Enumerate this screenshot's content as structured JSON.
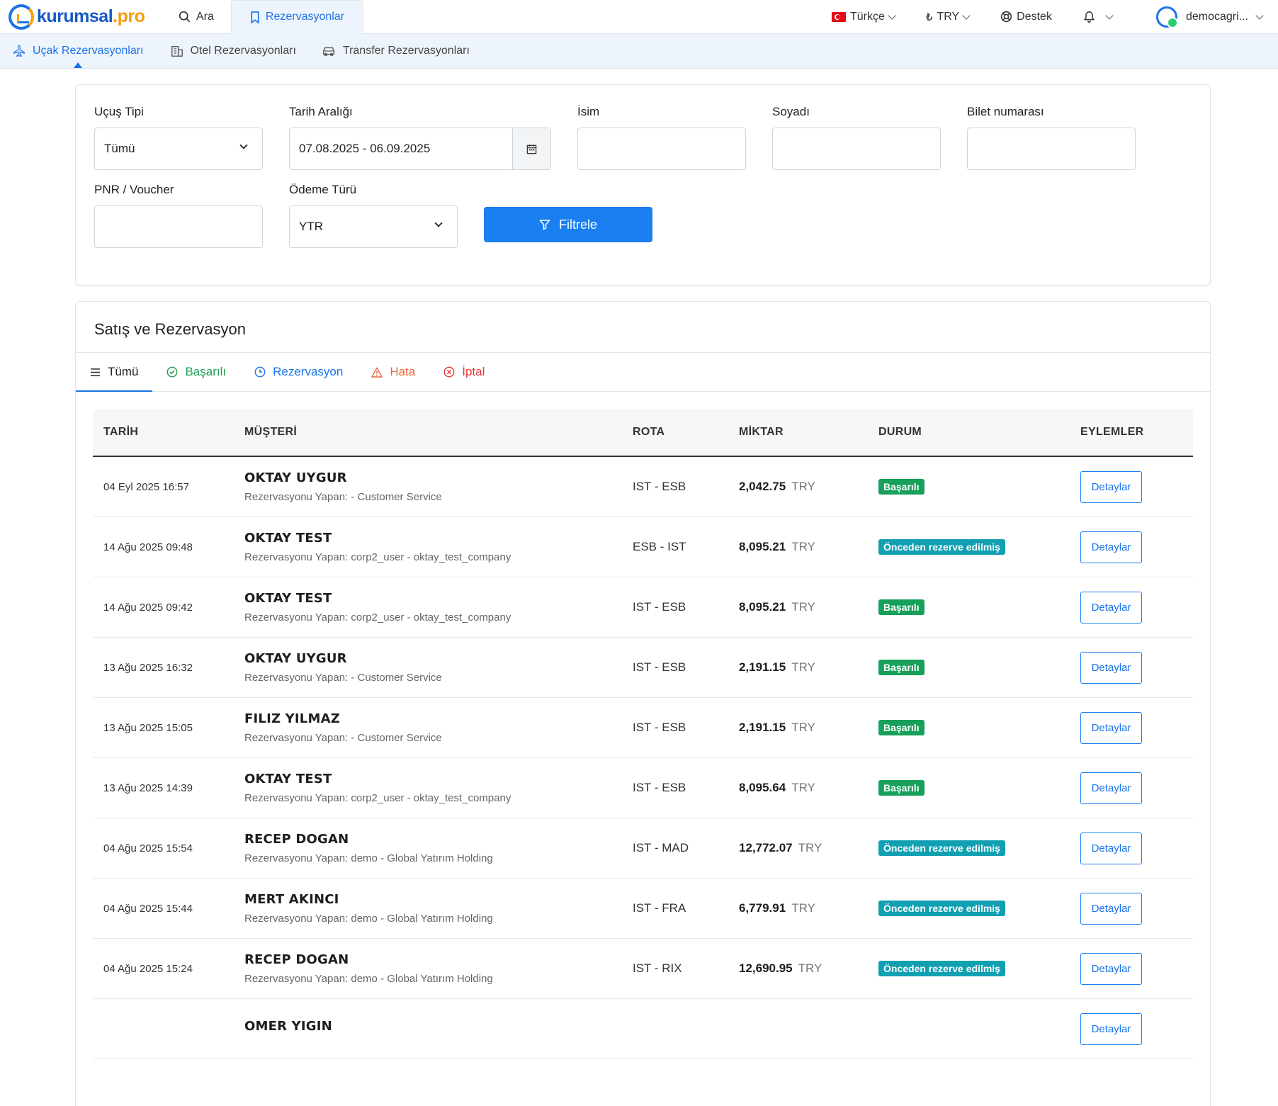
{
  "topnav": {
    "logo_main": "kurumsal",
    "logo_suffix": ".pro",
    "search_label": "Ara",
    "reservations_label": "Rezervasyonlar",
    "language": "Türkçe",
    "currency": "TRY",
    "support": "Destek",
    "username": "democagri..."
  },
  "subnav": {
    "items": [
      "Uçak Rezervasyonları",
      "Otel Rezervasyonları",
      "Transfer Rezervasyonları"
    ]
  },
  "filters": {
    "flight_type_label": "Uçuş Tipi",
    "flight_type_value": "Tümü",
    "date_range_label": "Tarih Aralığı",
    "date_range_value": "07.08.2025 - 06.09.2025",
    "name_label": "İsim",
    "surname_label": "Soyadı",
    "ticket_label": "Bilet numarası",
    "pnr_label": "PNR / Voucher",
    "payment_label": "Ödeme Türü",
    "payment_value": "YTR",
    "filter_button": "Filtrele"
  },
  "results": {
    "title": "Satış ve Rezervasyon",
    "tabs": [
      "Tümü",
      "Başarılı",
      "Rezervasyon",
      "Hata",
      "İptal"
    ],
    "columns": [
      "TARİH",
      "MÜŞTERİ",
      "ROTA",
      "MİKTAR",
      "DURUM",
      "EYLEMLER"
    ],
    "detail_label": "Detaylar",
    "rows": [
      {
        "date": "04 Eyl 2025 16:57",
        "name": "OKTAY UYGUR",
        "by": "Rezervasyonu Yapan: - Customer Service",
        "route": "IST - ESB",
        "amount": "2,042.75",
        "currency": "TRY",
        "status": "Başarılı",
        "status_type": "ok"
      },
      {
        "date": "14 Ağu 2025 09:48",
        "name": "OKTAY TEST",
        "by": "Rezervasyonu Yapan: corp2_user - oktay_test_company",
        "route": "ESB - IST",
        "amount": "8,095.21",
        "currency": "TRY",
        "status": "Önceden rezerve edilmiş",
        "status_type": "pre"
      },
      {
        "date": "14 Ağu 2025 09:42",
        "name": "OKTAY TEST",
        "by": "Rezervasyonu Yapan: corp2_user - oktay_test_company",
        "route": "IST - ESB",
        "amount": "8,095.21",
        "currency": "TRY",
        "status": "Başarılı",
        "status_type": "ok"
      },
      {
        "date": "13 Ağu 2025 16:32",
        "name": "OKTAY UYGUR",
        "by": "Rezervasyonu Yapan: - Customer Service",
        "route": "IST - ESB",
        "amount": "2,191.15",
        "currency": "TRY",
        "status": "Başarılı",
        "status_type": "ok"
      },
      {
        "date": "13 Ağu 2025 15:05",
        "name": "FILIZ YILMAZ",
        "by": "Rezervasyonu Yapan: - Customer Service",
        "route": "IST - ESB",
        "amount": "2,191.15",
        "currency": "TRY",
        "status": "Başarılı",
        "status_type": "ok"
      },
      {
        "date": "13 Ağu 2025 14:39",
        "name": "OKTAY TEST",
        "by": "Rezervasyonu Yapan: corp2_user - oktay_test_company",
        "route": "IST - ESB",
        "amount": "8,095.64",
        "currency": "TRY",
        "status": "Başarılı",
        "status_type": "ok"
      },
      {
        "date": "04 Ağu 2025 15:54",
        "name": "RECEP DOGAN",
        "by": "Rezervasyonu Yapan: demo - Global Yatırım Holding",
        "route": "IST - MAD",
        "amount": "12,772.07",
        "currency": "TRY",
        "status": "Önceden rezerve edilmiş",
        "status_type": "pre"
      },
      {
        "date": "04 Ağu 2025 15:44",
        "name": "MERT AKINCI",
        "by": "Rezervasyonu Yapan: demo - Global Yatırım Holding",
        "route": "IST - FRA",
        "amount": "6,779.91",
        "currency": "TRY",
        "status": "Önceden rezerve edilmiş",
        "status_type": "pre"
      },
      {
        "date": "04 Ağu 2025 15:24",
        "name": "RECEP DOGAN",
        "by": "Rezervasyonu Yapan: demo - Global Yatırım Holding",
        "route": "IST - RIX",
        "amount": "12,690.95",
        "currency": "TRY",
        "status": "Önceden rezerve edilmiş",
        "status_type": "pre"
      },
      {
        "date": "",
        "name": "OMER YIGIN",
        "by": "",
        "route": "",
        "amount": "",
        "currency": "",
        "status": "",
        "status_type": "none"
      }
    ]
  },
  "colors": {
    "primary": "#1a7ff0",
    "success": "#16a05a",
    "prereserved": "#10a0b2",
    "error": "#e8663d",
    "cancel": "#e53935"
  }
}
